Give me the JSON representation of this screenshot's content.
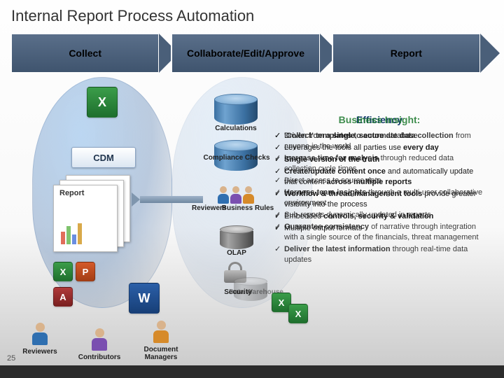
{
  "title": "Internal Report Process Automation",
  "chevrons": [
    "Collect",
    "Collaborate/Edit/Approve",
    "Report"
  ],
  "cdm_label": "CDM",
  "doc_label": "Report",
  "mid_labels": {
    "calculations": "Calculations",
    "compliance": "Compliance Checks",
    "business_rules": "Business Rules",
    "reviewers_mid": "Reviewers",
    "olap": "OLAP",
    "dw": "Data Warehouse",
    "security": "Security"
  },
  "roles": {
    "reviewers": "Reviewers",
    "contributors": "Contributors",
    "docmanagers": "Document Managers"
  },
  "icons": {
    "xl": "X",
    "wd": "W",
    "pp": "P",
    "ac": "A"
  },
  "right": {
    "title_a": "Efficiency",
    "title_b": "Business Insight:",
    "layer1": [
      "Driven from a <strong>single</strong>, <strong>secure</strong> database",
      "Leverages the tools all parties use <strong>every day</strong>",
      "<strong>Single version of the truth</strong>",
      "<strong>Create/update content once</strong> and automatically update that content <strong>across multiple reports</strong>",
      "<strong>Workflow & thread management tools</strong> provide greater visibility into the process",
      "Embedded <strong>controls, security & validation</strong>",
      "Multiple output formats"
    ],
    "layer2": [
      "<strong>'Collect' templates to automate data collection</strong> from anyone in the world",
      "<strong>Increase time for analysis</strong> through reduced data collection cycle times",
      "Direct access to source data",
      "<strong>Harness team insights</strong> through a multi-user collaborative environment",
      "Sub-reports dynamically updated in reports",
      "<strong>Guarantee consistency</strong> of narrative through integration with a single source of the financials, threat management",
      "<strong>Deliver the latest information</strong> through real-time data updates"
    ]
  },
  "pagenum": "25"
}
